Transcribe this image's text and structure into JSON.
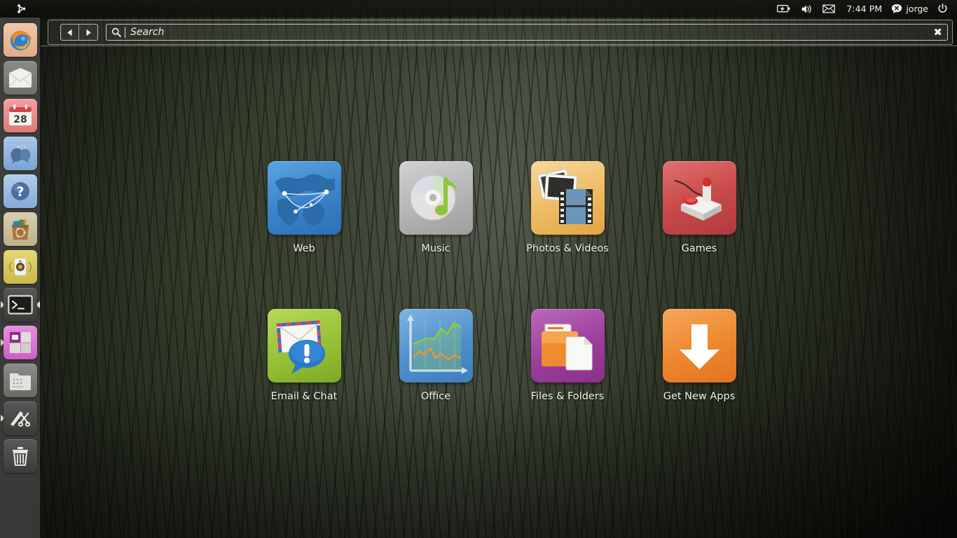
{
  "panel": {
    "logo_icon": "ubuntu-logo-icon",
    "indicators": [
      {
        "name": "battery-indicator",
        "icon": "battery-charging-icon",
        "label": ""
      },
      {
        "name": "volume-indicator",
        "icon": "speaker-volume-icon",
        "label": ""
      },
      {
        "name": "messaging-indicator",
        "icon": "envelope-icon",
        "label": ""
      }
    ],
    "clock": "7:44 PM",
    "user": {
      "name": "jorge",
      "status_icon": "chat-offline-icon"
    },
    "power": {
      "icon": "power-icon"
    }
  },
  "dash": {
    "back_icon": "arrow-left-icon",
    "forward_icon": "arrow-right-icon",
    "search_icon": "magnifier-icon",
    "search_value": "",
    "search_placeholder": "Search",
    "clear_icon": "clear-x-icon"
  },
  "launcher": {
    "items": [
      {
        "name": "launcher-item-firefox",
        "label": "Firefox Web Browser",
        "icon": "firefox-icon",
        "running": false
      },
      {
        "name": "launcher-item-mail",
        "label": "Mail",
        "icon": "envelope-icon",
        "running": false
      },
      {
        "name": "launcher-item-calendar",
        "label": "Calendar",
        "icon": "calendar-icon",
        "day": "28",
        "running": false
      },
      {
        "name": "launcher-item-chat",
        "label": "Chat",
        "icon": "chat-bubbles-icon",
        "running": false
      },
      {
        "name": "launcher-item-help",
        "label": "Help",
        "icon": "question-mark-icon",
        "running": false
      },
      {
        "name": "launcher-item-software-center",
        "label": "Ubuntu Software Center",
        "icon": "shopping-bag-icon",
        "running": false
      },
      {
        "name": "launcher-item-music-player",
        "label": "Music Player",
        "icon": "speaker-icon",
        "running": false
      },
      {
        "name": "launcher-item-terminal",
        "label": "Terminal",
        "icon": "terminal-icon",
        "running": true
      },
      {
        "name": "launcher-item-workspace-switcher",
        "label": "Workspace Switcher",
        "icon": "workspace-grid-icon",
        "running": true
      },
      {
        "name": "launcher-item-files",
        "label": "Files",
        "icon": "file-manager-icon",
        "running": false
      },
      {
        "name": "launcher-item-editor",
        "label": "Editor",
        "icon": "scissors-icon",
        "running": true
      },
      {
        "name": "launcher-item-trash",
        "label": "Trash",
        "icon": "trash-icon",
        "running": false
      }
    ]
  },
  "categories": [
    {
      "name": "category-web",
      "label": "Web",
      "icon": "globe-network-icon",
      "color": "#3d8ed4"
    },
    {
      "name": "category-music",
      "label": "Music",
      "icon": "cd-music-note-icon",
      "color": "#b9b9b9"
    },
    {
      "name": "category-photos-videos",
      "label": "Photos & Videos",
      "icon": "photos-film-icon",
      "color": "#f0c070"
    },
    {
      "name": "category-games",
      "label": "Games",
      "icon": "joystick-icon",
      "color": "#d05050"
    },
    {
      "name": "category-email-chat",
      "label": "Email & Chat",
      "icon": "envelope-chat-icon",
      "color": "#9cc43c"
    },
    {
      "name": "category-office",
      "label": "Office",
      "icon": "line-chart-icon",
      "color": "#5e9ad4"
    },
    {
      "name": "category-files-folders",
      "label": "Files & Folders",
      "icon": "folder-document-icon",
      "color": "#a8459e"
    },
    {
      "name": "category-get-new-apps",
      "label": "Get New Apps",
      "icon": "download-arrow-icon",
      "color": "#ef8a31"
    }
  ],
  "colors": {
    "panel_bg": "#14160f",
    "launcher_bg": "#3c3c3a",
    "text": "#f4f4ef",
    "wallpaper_base": "#3e4636"
  }
}
